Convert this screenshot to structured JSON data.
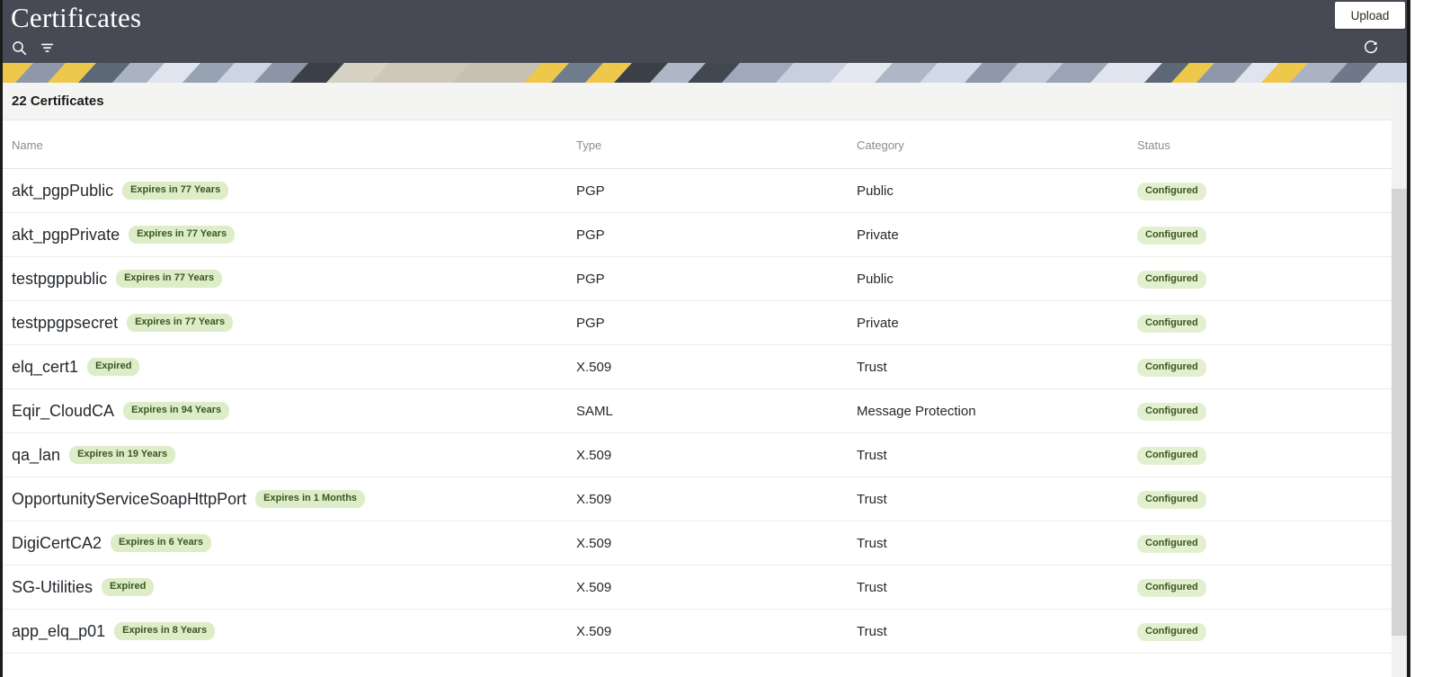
{
  "header": {
    "title": "Certificates",
    "upload_label": "Upload",
    "search_icon": "search-icon",
    "filter_icon": "filter-icon",
    "refresh_icon": "refresh-icon"
  },
  "summary": {
    "count_text": "22 Certificates"
  },
  "table": {
    "columns": [
      "Name",
      "Type",
      "Category",
      "Status"
    ],
    "rows": [
      {
        "name": "akt_pgpPublic",
        "expiry": "Expires in 77 Years",
        "type": "PGP",
        "category": "Public",
        "status": "Configured"
      },
      {
        "name": "akt_pgpPrivate",
        "expiry": "Expires in 77 Years",
        "type": "PGP",
        "category": "Private",
        "status": "Configured"
      },
      {
        "name": "testpgppublic",
        "expiry": "Expires in 77 Years",
        "type": "PGP",
        "category": "Public",
        "status": "Configured"
      },
      {
        "name": "testppgpsecret",
        "expiry": "Expires in 77 Years",
        "type": "PGP",
        "category": "Private",
        "status": "Configured"
      },
      {
        "name": "elq_cert1",
        "expiry": "Expired",
        "type": "X.509",
        "category": "Trust",
        "status": "Configured"
      },
      {
        "name": "Eqir_CloudCA",
        "expiry": "Expires in 94 Years",
        "type": "SAML",
        "category": "Message Protection",
        "status": "Configured"
      },
      {
        "name": "qa_lan",
        "expiry": "Expires in 19 Years",
        "type": "X.509",
        "category": "Trust",
        "status": "Configured"
      },
      {
        "name": "OpportunityServiceSoapHttpPort",
        "expiry": "Expires in 1 Months",
        "type": "X.509",
        "category": "Trust",
        "status": "Configured"
      },
      {
        "name": "DigiCertCA2",
        "expiry": "Expires in 6 Years",
        "type": "X.509",
        "category": "Trust",
        "status": "Configured"
      },
      {
        "name": "SG-Utilities",
        "expiry": "Expired",
        "type": "X.509",
        "category": "Trust",
        "status": "Configured"
      },
      {
        "name": "app_elq_p01",
        "expiry": "Expires in 8 Years",
        "type": "X.509",
        "category": "Trust",
        "status": "Configured"
      }
    ]
  },
  "colors": {
    "topbar": "#474a54",
    "badge_bg": "#dcedc8",
    "badge_text": "#3c5521",
    "count_band": "#f4f4f2",
    "scrollbar_thumb": "#d4d4d4"
  }
}
